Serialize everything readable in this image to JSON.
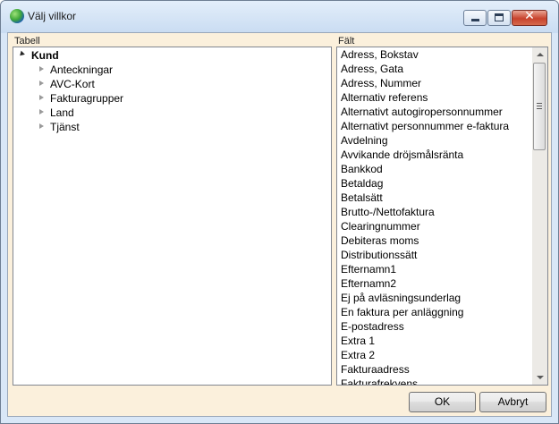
{
  "window": {
    "title": "Välj villkor"
  },
  "labels": {
    "tabell": "Tabell",
    "falt": "Fält"
  },
  "tree": {
    "root": {
      "label": "Kund",
      "expanded": true
    },
    "children": [
      {
        "label": "Anteckningar"
      },
      {
        "label": "AVC-Kort"
      },
      {
        "label": "Fakturagrupper"
      },
      {
        "label": "Land"
      },
      {
        "label": "Tjänst"
      }
    ]
  },
  "fields": [
    "Adress, Bokstav",
    "Adress, Gata",
    "Adress, Nummer",
    "Alternativ referens",
    "Alternativt autogiropersonnummer",
    "Alternativt personnummer e-faktura",
    "Avdelning",
    "Avvikande dröjsmålsränta",
    "Bankkod",
    "Betaldag",
    "Betalsätt",
    "Brutto-/Nettofaktura",
    "Clearingnummer",
    "Debiteras moms",
    "Distributionssätt",
    "Efternamn1",
    "Efternamn2",
    "Ej på avläsningsunderlag",
    "En faktura per anläggning",
    "E-postadress",
    "Extra 1",
    "Extra 2",
    "Fakturaadress",
    "Fakturafrekvens"
  ],
  "buttons": {
    "ok": "OK",
    "cancel": "Avbryt"
  },
  "icons": {
    "app": "app-globe-icon",
    "minimize": "minimize-icon",
    "maximize": "maximize-icon",
    "close": "close-icon"
  }
}
